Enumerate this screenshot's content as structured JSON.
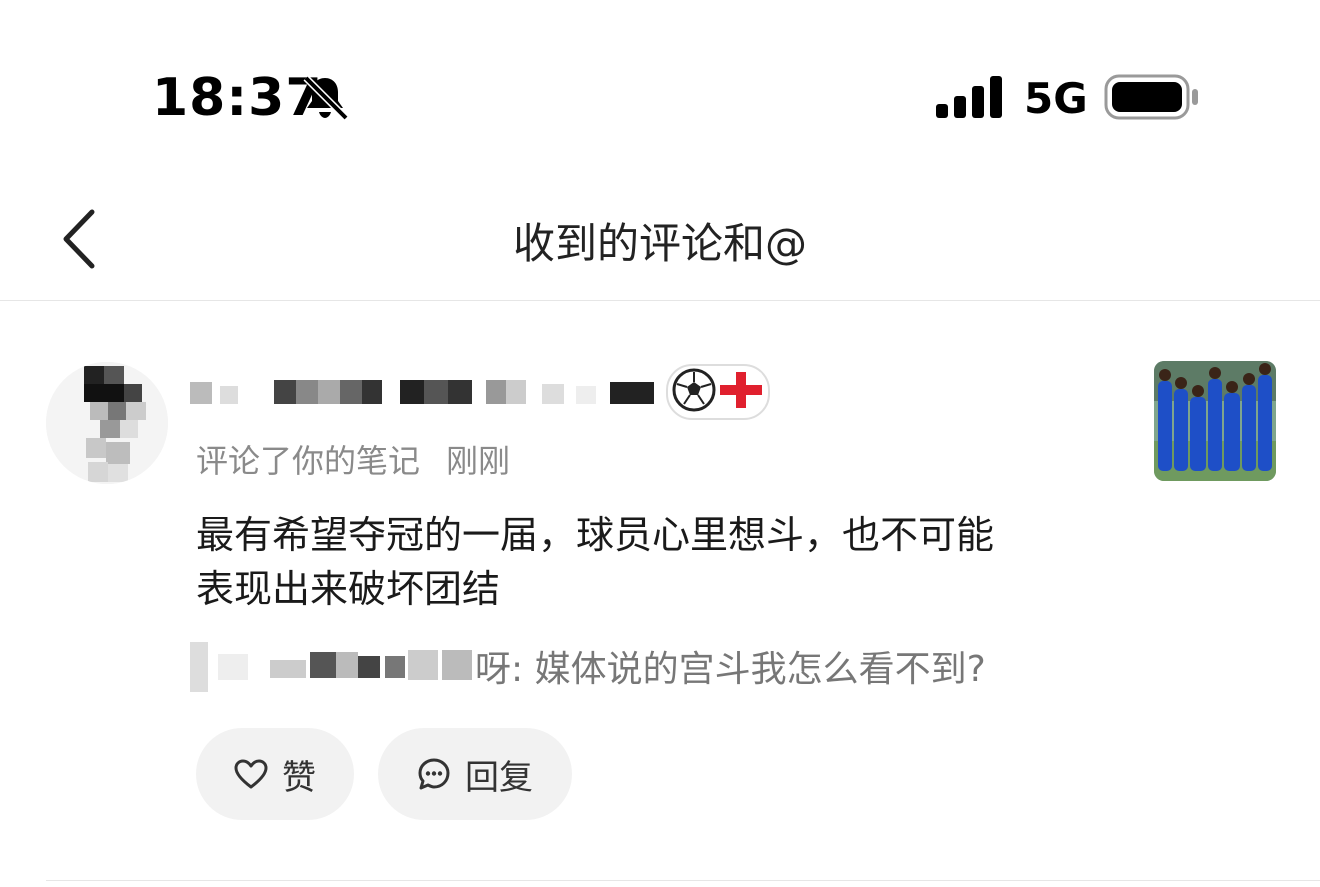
{
  "status_bar": {
    "time": "18:37",
    "network": "5G",
    "icons": [
      "bell-slash-icon",
      "signal-icon",
      "battery-icon"
    ]
  },
  "nav": {
    "back_icon": "chevron-left-icon",
    "title": "收到的评论和@"
  },
  "comment": {
    "badge_icons": [
      "soccer-ball-icon",
      "england-flag-icon"
    ],
    "action": "评论了你的笔记",
    "time": "刚刚",
    "text_line1": "最有希望夺冠的一届，球员心里想斗，也不可能",
    "text_line2": "表现出来破坏团结",
    "quote_suffix": "呀: 媒体说的宫斗我怎么看不到?",
    "like_label": "赞",
    "reply_label": "回复"
  },
  "colors": {
    "accent_gray": "#f2f2f2",
    "meta_text": "#8a8a8a",
    "flag_red": "#e0202e",
    "jersey_blue": "#1e4fc7"
  }
}
